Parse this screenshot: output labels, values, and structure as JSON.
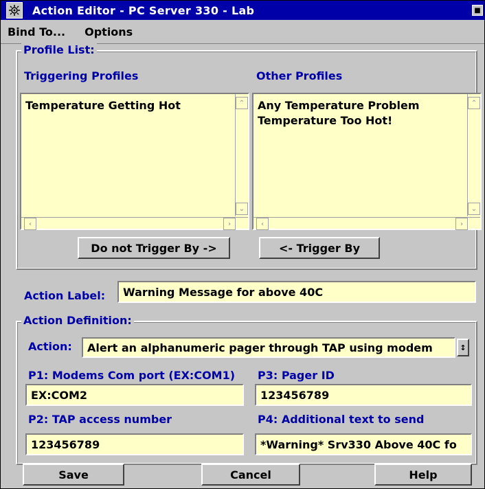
{
  "window": {
    "title": "Action Editor - PC Server 330 - Lab",
    "system_icon": "gear-icon",
    "minimize_icon": "minimize-icon"
  },
  "menu": {
    "bind_to": "Bind To...",
    "options": "Options"
  },
  "profile_list": {
    "group_label": "Profile List:",
    "triggering_label": "Triggering Profiles",
    "triggering_items": [
      "Temperature Getting Hot"
    ],
    "other_label": "Other Profiles",
    "other_items": [
      "Any Temperature Problem",
      "Temperature Too Hot!"
    ],
    "do_not_trigger_button": "Do not Trigger By ->",
    "trigger_button": "<- Trigger By"
  },
  "action_label": {
    "label": "Action Label:",
    "value": "Warning Message for above 40C"
  },
  "action_definition": {
    "group_label": "Action Definition:",
    "action_label": "Action:",
    "action_value": "Alert an alphanumeric pager through TAP using modem",
    "p1_label": "P1: Modems Com port (EX:COM1)",
    "p1_value": "EX:COM2",
    "p2_label": "P2: TAP access number",
    "p2_value": "123456789",
    "p3_label": "P3: Pager ID",
    "p3_value": "123456789",
    "p4_label": "P4: Additional text to send",
    "p4_value": "*Warning* Srv330 Above 40C fo"
  },
  "buttons": {
    "save": "Save",
    "cancel": "Cancel",
    "help": "Help"
  }
}
